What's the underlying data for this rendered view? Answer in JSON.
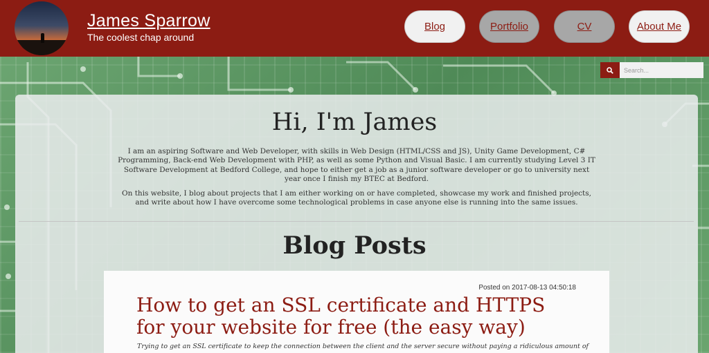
{
  "header": {
    "title": "James Sparrow",
    "tagline": "The coolest chap around",
    "nav": [
      {
        "label": "Blog"
      },
      {
        "label": "Portfolio"
      },
      {
        "label": "CV"
      },
      {
        "label": "About Me"
      }
    ]
  },
  "search": {
    "placeholder": "Search...",
    "icon": "search-icon"
  },
  "intro": {
    "heading": "Hi, I'm James",
    "paragraph1": "I am an aspiring Software and Web Developer, with skills in Web Design (HTML/CSS and JS), Unity Game Development, C# Programming, Back-end Web Development with PHP, as well as some Python and Visual Basic. I am currently studying Level 3 IT Software Development at Bedford College, and hope to either get a job as a junior software developer or go to university next year once I finish my BTEC at Bedford.",
    "paragraph2": "On this website, I blog about projects that I am either working on or have completed, showcase my work and finished projects, and write about how I have overcome some technological problems in case anyone else is running into the same issues."
  },
  "blog": {
    "heading": "Blog Posts",
    "posts": [
      {
        "date": "Posted on 2017-08-13 04:50:18",
        "title": "How to get an SSL certificate and HTTPS for your website for free (the easy way)",
        "excerpt": "Trying to get an SSL certificate to keep the connection between the client and the server secure without paying a ridiculous amount of"
      }
    ]
  },
  "colors": {
    "brand": "#8c1c13",
    "nav_light": "#f1f1f1",
    "nav_dark": "#a7a7a7"
  }
}
